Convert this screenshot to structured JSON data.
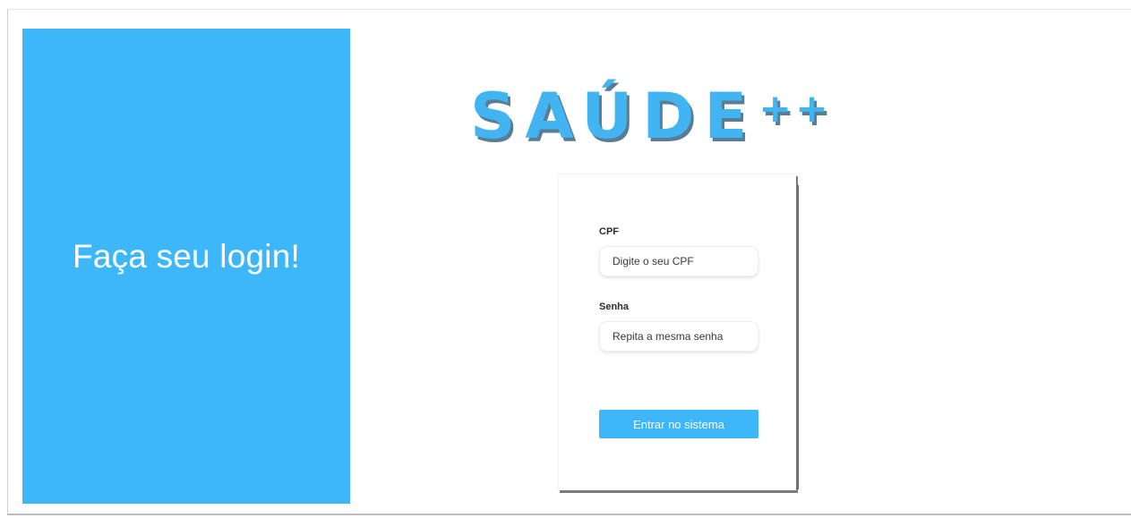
{
  "left_panel": {
    "title": "Faça seu login!"
  },
  "logo": {
    "text": "SAÚDE",
    "suffix": "++"
  },
  "form": {
    "cpf_label": "CPF",
    "cpf_placeholder": "Digite o seu CPF",
    "cpf_value": "",
    "password_label": "Senha",
    "password_placeholder": "Repita a mesma senha",
    "password_value": "",
    "submit_label": "Entrar no sistema"
  },
  "colors": {
    "accent": "#3db7fa",
    "logo": "#42b4f2",
    "logo_shadow": "#5a7d95"
  }
}
